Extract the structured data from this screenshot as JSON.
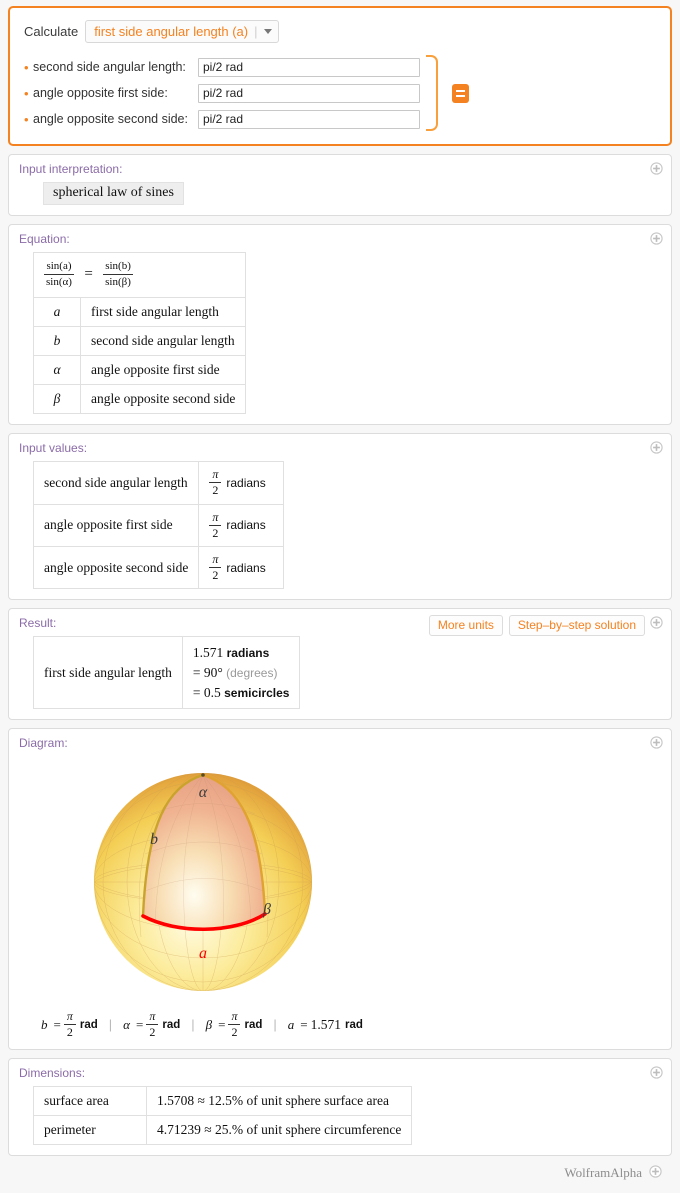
{
  "input_pod": {
    "calculate_label": "Calculate",
    "selected_quantity": "first side angular length (a)",
    "separator": "|",
    "fields": [
      {
        "label": "second side angular length:",
        "value": "pi/2 rad"
      },
      {
        "label": "angle opposite first side:",
        "value": "pi/2 rad"
      },
      {
        "label": "angle opposite second side:",
        "value": "pi/2 rad"
      }
    ],
    "equals_button_icon": "equals-icon",
    "accent_color": "#f58220"
  },
  "input_interpretation": {
    "title": "Input interpretation:",
    "chip": "spherical law of sines"
  },
  "equation": {
    "title": "Equation:",
    "formula": {
      "left": {
        "numerator": "sin(a)",
        "denominator": "sin(α)"
      },
      "operator": "=",
      "right": {
        "numerator": "sin(b)",
        "denominator": "sin(β)"
      }
    },
    "variables": [
      {
        "symbol": "a",
        "meaning": "first side angular length"
      },
      {
        "symbol": "b",
        "meaning": "second side angular length"
      },
      {
        "symbol": "α",
        "meaning": "angle opposite first side"
      },
      {
        "symbol": "β",
        "meaning": "angle opposite second side"
      }
    ]
  },
  "input_values": {
    "title": "Input values:",
    "rows": [
      {
        "name": "second side angular length",
        "num": "π",
        "den": "2",
        "unit": "radians"
      },
      {
        "name": "angle opposite first side",
        "num": "π",
        "den": "2",
        "unit": "radians"
      },
      {
        "name": "angle opposite second side",
        "num": "π",
        "den": "2",
        "unit": "radians"
      }
    ]
  },
  "result": {
    "title": "Result:",
    "more_units_label": "More units",
    "step_by_step_label": "Step–by–step solution",
    "row_name": "first side angular length",
    "primary_value": "1.571",
    "primary_unit": "radians",
    "alt_1_value": "= 90°",
    "alt_1_unit": "(degrees)",
    "alt_2_value": "= 0.5",
    "alt_2_unit": "semicircles"
  },
  "diagram": {
    "title": "Diagram:",
    "labels": {
      "alpha": "α",
      "b": "b",
      "beta": "β",
      "a": "a"
    },
    "arc_color": "#ff0000",
    "sphere_colors": {
      "light": "#fdf0a8",
      "mid": "#f5d24a",
      "orange": "#e8953e",
      "pink": "#f0b08c"
    },
    "caption": [
      {
        "symbol": "b",
        "eq": "=",
        "num": "π",
        "den": "2",
        "unit": "rad"
      },
      {
        "symbol": "α",
        "eq": "=",
        "num": "π",
        "den": "2",
        "unit": "rad"
      },
      {
        "symbol": "β",
        "eq": "=",
        "num": "π",
        "den": "2",
        "unit": "rad"
      },
      {
        "symbol": "a",
        "eq": "=",
        "value": "1.571",
        "unit": "rad"
      }
    ],
    "caption_separator": "|"
  },
  "dimensions": {
    "title": "Dimensions:",
    "rows": [
      {
        "name": "surface area",
        "value": "1.5708 ≈ 12.5% of unit sphere surface area"
      },
      {
        "name": "perimeter",
        "value": "4.71239 ≈ 25.% of unit sphere circumference"
      }
    ]
  },
  "footer": {
    "brand": "WolframAlpha"
  },
  "icons": {
    "expand": "plus-circle-icon"
  }
}
